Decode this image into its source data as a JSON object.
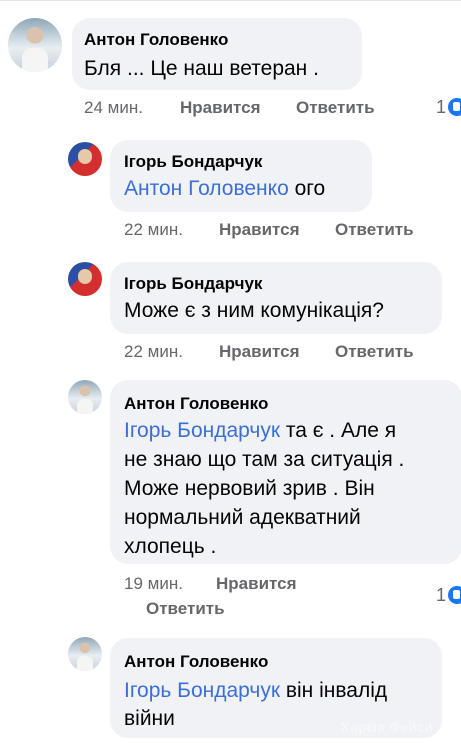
{
  "comments": [
    {
      "author": "Антон Головенко",
      "text": "Бля ... Це наш ветеран .",
      "time": "24 мин.",
      "like": "Нравится",
      "reply": "Ответить",
      "reaction_count": "1"
    },
    {
      "author": "Ігорь Бондарчук",
      "mention": "Антон Головенко",
      "text": " ого",
      "time": "22 мин.",
      "like": "Нравится",
      "reply": "Ответить"
    },
    {
      "author": "Ігорь Бондарчук",
      "text": "Може є з ним комунікація?",
      "time": "22 мин.",
      "like": "Нравится",
      "reply": "Ответить"
    },
    {
      "author": "Антон Головенко",
      "mention": "Ігорь Бондарчук",
      "text_line1": " та є . Але я",
      "text_line2": "не знаю що там за ситуація .",
      "text_line3": "Може нервовий зрив . Він",
      "text_line4": "нормальний адекватний",
      "text_line5": "хлопець .",
      "time": "19 мин.",
      "like": "Нравится",
      "reply": "Ответить",
      "reaction_count": "1"
    },
    {
      "author": "Антон Головенко",
      "mention": "Ігорь Бондарчук",
      "text_line1": " він інвалід",
      "text_line2": "війни"
    }
  ],
  "watermark": "Харків Фейси",
  "colors": {
    "bubble": "#f0f2f5",
    "mention": "#3b6fd8",
    "meta": "#65676b",
    "like_icon": "#1877f2"
  }
}
